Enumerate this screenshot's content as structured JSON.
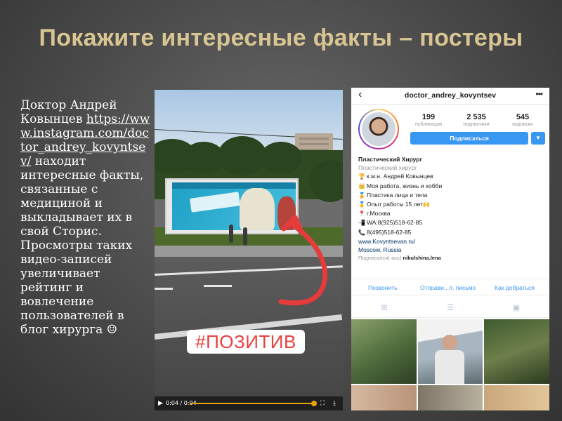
{
  "slide": {
    "title": "Покажите интересные факты – постеры",
    "body_intro": "Доктор Андрей Ковынцев",
    "body_link": "https://www.instagram.com/doctor_andrey_kovyntsev/",
    "body_rest": " находит интересные факты, связанные с медициной и выкладывает их в свой Сторис. Просмотры таких видео-записей увеличивает рейтинг и вовлечение пользователей в блог хирурга ☺"
  },
  "story": {
    "hashtag": "#ПОЗИТИВ",
    "video_time": "0:04 / 0:04",
    "progress": 1.0
  },
  "instagram": {
    "username": "doctor_andrey_kovyntsev",
    "stats": [
      {
        "num": "199",
        "label": "публикации"
      },
      {
        "num": "2 535",
        "label": "подписчики"
      },
      {
        "num": "545",
        "label": "подписки"
      }
    ],
    "follow_label": "Подписаться",
    "bio": {
      "name": "Пластический Хирург",
      "category": "Пластический хирург",
      "lines": [
        {
          "icon": "trophy-icon",
          "glyph": "🏆",
          "text": "к.м.н. Андрей Ковынцев"
        },
        {
          "icon": "crown-icon",
          "glyph": "👑",
          "text": "Моя работа, жизнь и хобби"
        },
        {
          "icon": "medal-icon",
          "glyph": "🏅",
          "text": "Пластика лица и тела"
        },
        {
          "icon": "medal-icon",
          "glyph": "🥇",
          "text": "Опыт работы 15 лет🙌"
        },
        {
          "icon": "pin-icon",
          "glyph": "📍",
          "text": "г.Москва"
        },
        {
          "icon": "phone-icon",
          "glyph": "📲",
          "text": "WA:8(925)518-62-85"
        },
        {
          "icon": "phone-icon",
          "glyph": "📞",
          "text": "8(495)518-62-85"
        }
      ],
      "website": "www.Kovyntsevan.ru/",
      "location": "Moscow, Russia",
      "followed_by_prefix": "Подписался(-ась) ",
      "followed_by_user": "nikulshina.lena"
    },
    "actions": [
      "Позвонить",
      "Отправи...л. письмо",
      "Как добраться"
    ]
  },
  "colors": {
    "title": "#d9c592",
    "ig_blue": "#3897f0",
    "hashtag_red": "#e8413e",
    "arrow_red": "#e63b3b"
  }
}
